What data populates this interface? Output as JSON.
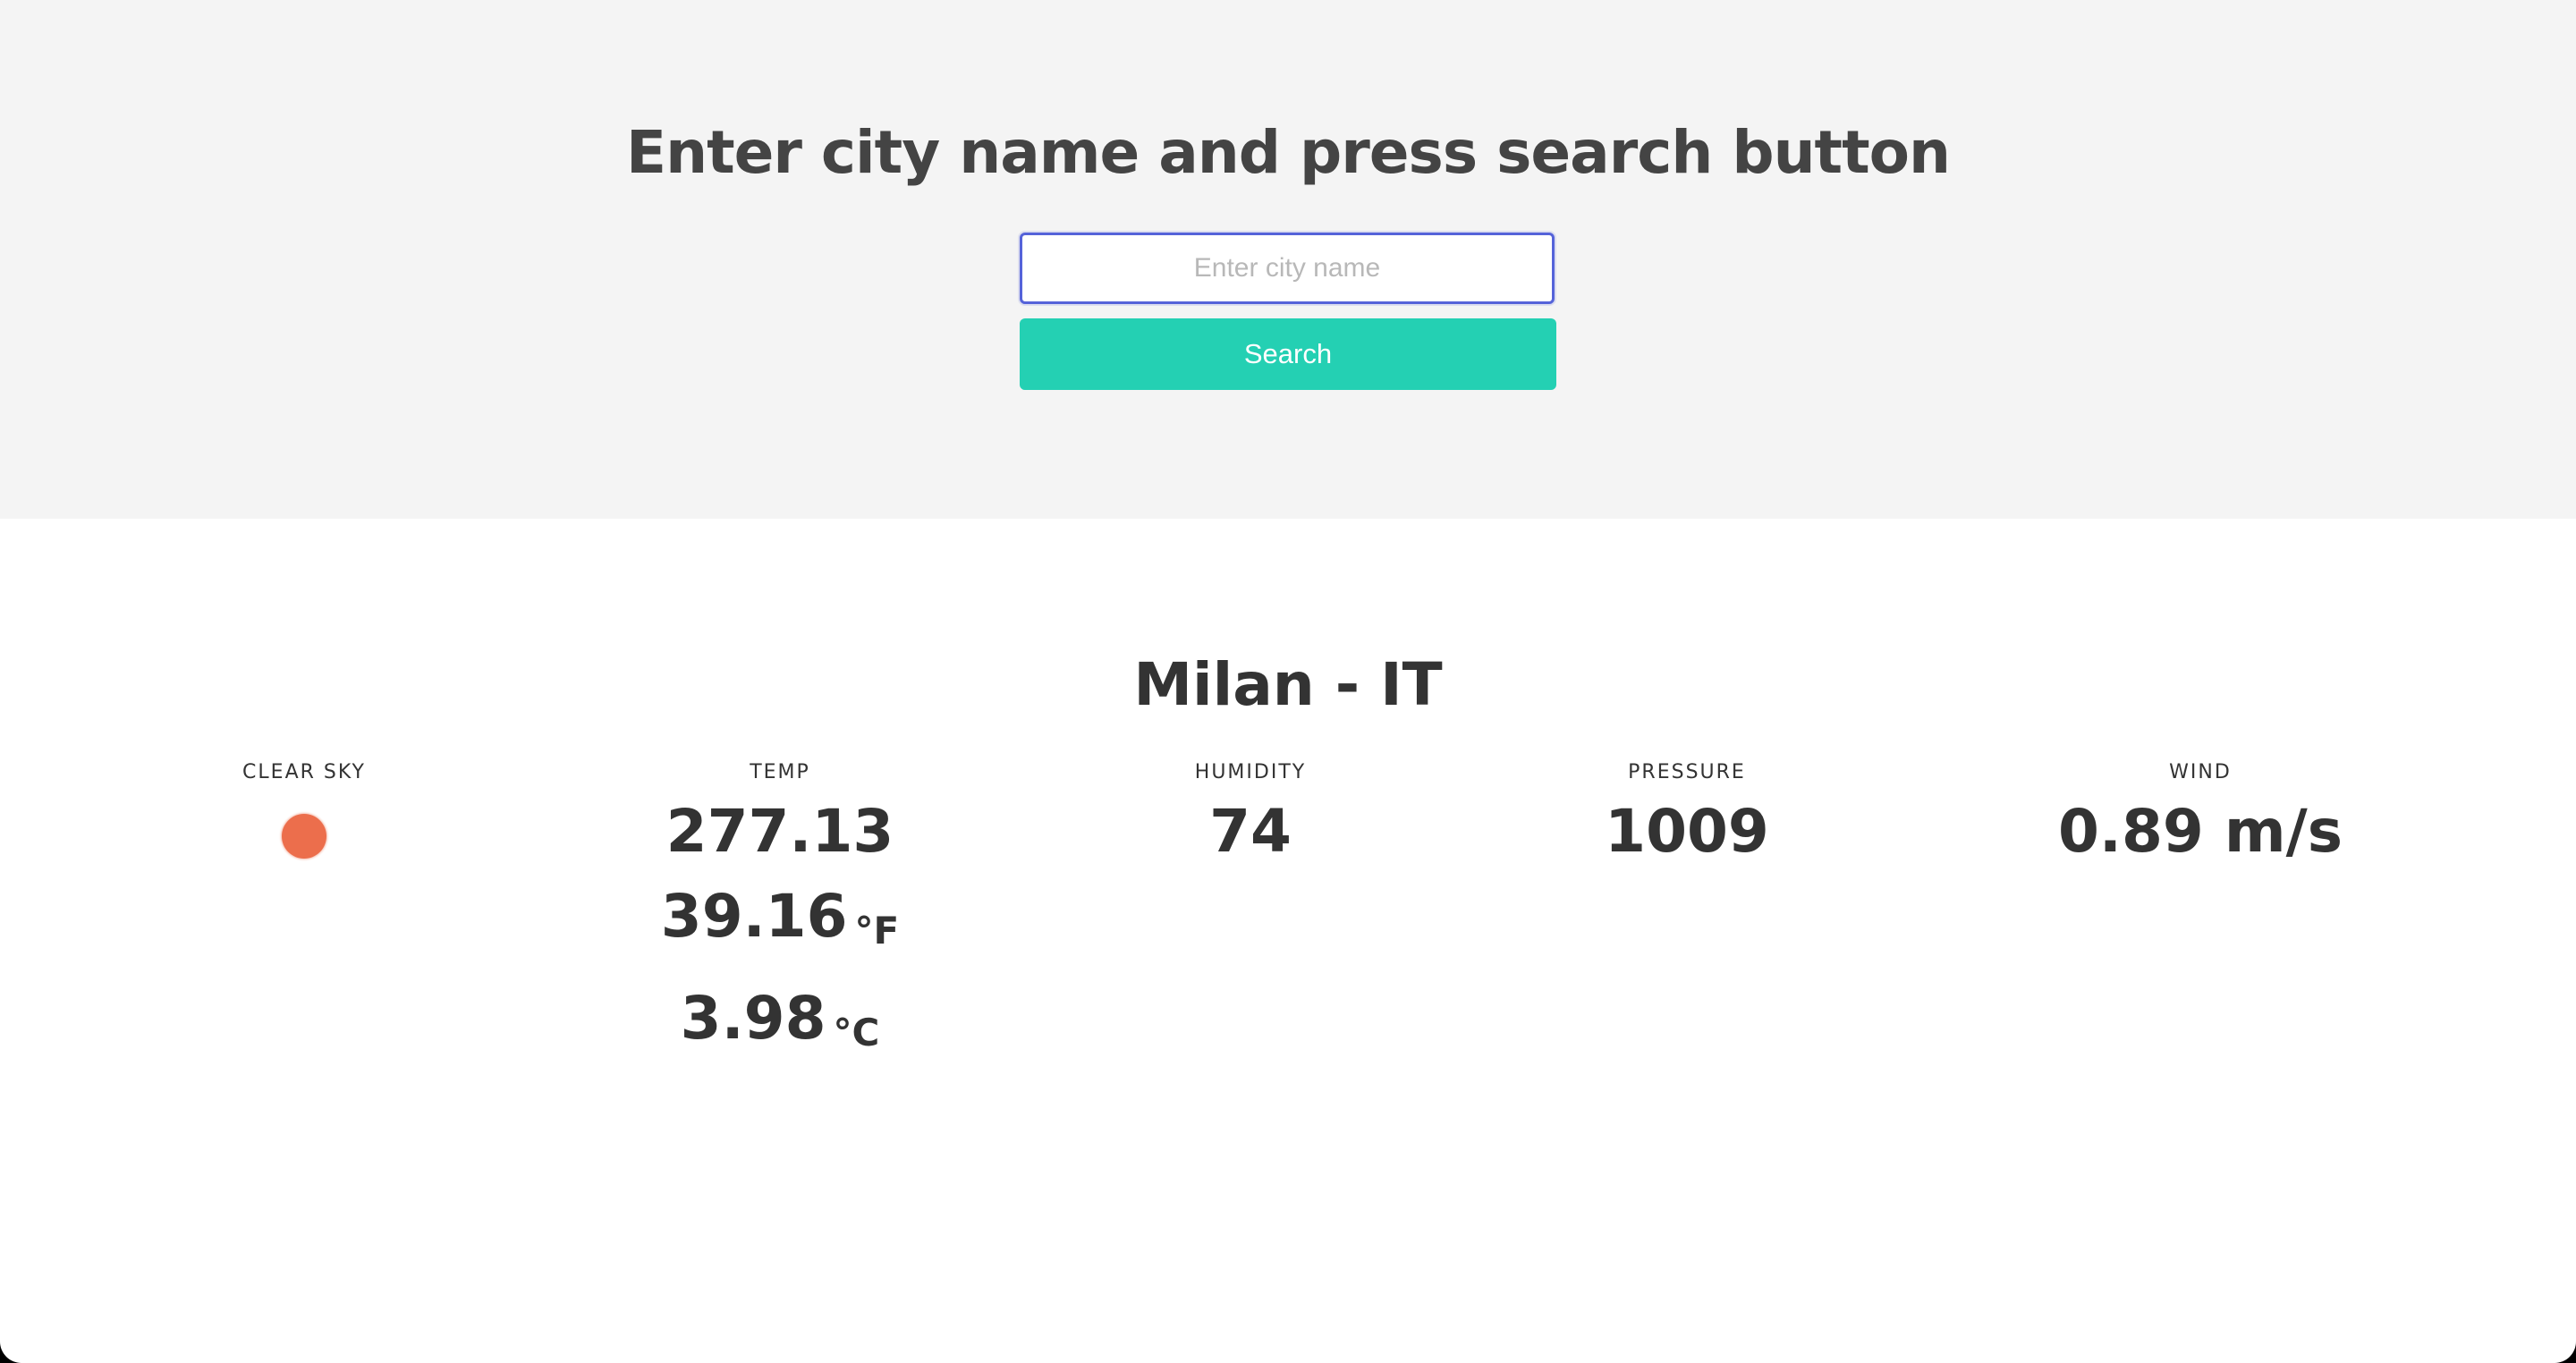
{
  "search_panel": {
    "headline": "Enter city name and press search button",
    "input_placeholder": "Enter city name",
    "input_value": "",
    "search_label": "Search"
  },
  "weather": {
    "city": "Milan - IT",
    "condition": {
      "label": "CLEAR SKY",
      "icon": "sun-icon",
      "icon_color": "#ec6e4c"
    },
    "temp": {
      "label": "TEMP",
      "kelvin": "277.13",
      "fahrenheit": "39.16",
      "fahrenheit_unit": "°F",
      "celsius": "3.98",
      "celsius_unit": "°C"
    },
    "humidity": {
      "label": "HUMIDITY",
      "value": "74"
    },
    "pressure": {
      "label": "PRESSURE",
      "value": "1009"
    },
    "wind": {
      "label": "WIND",
      "value": "0.89 m/s"
    }
  },
  "colors": {
    "accent": "#24d0b3",
    "input_focus_border": "#5563d9",
    "panel_background": "#f4f4f4"
  }
}
